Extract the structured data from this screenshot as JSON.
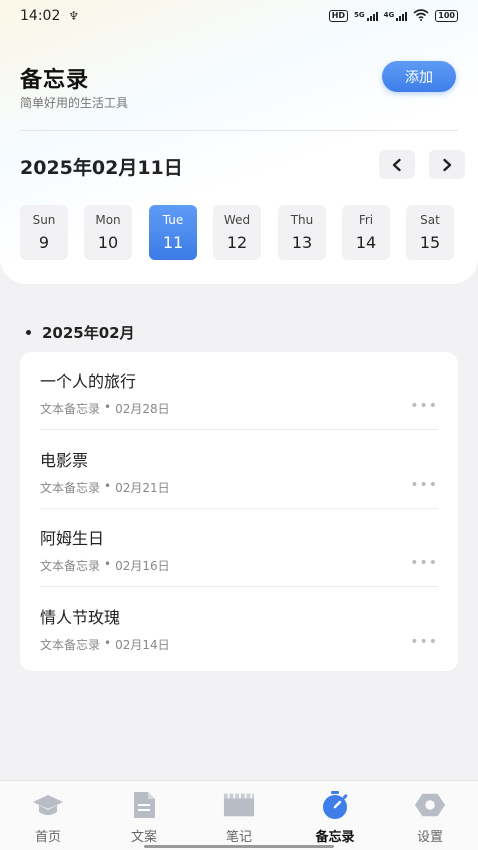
{
  "status_bar": {
    "time": "14:02",
    "hd_label": "HD",
    "net1": "5G",
    "net2": "4G",
    "battery": "100"
  },
  "header": {
    "title": "备忘录",
    "subtitle": "简单好用的生活工具",
    "add_label": "添加",
    "accent_color": "#4a88ee"
  },
  "calendar": {
    "current_date": "2025年02月11日",
    "days": [
      {
        "name": "Sun",
        "num": "9",
        "active": false
      },
      {
        "name": "Mon",
        "num": "10",
        "active": false
      },
      {
        "name": "Tue",
        "num": "11",
        "active": true
      },
      {
        "name": "Wed",
        "num": "12",
        "active": false
      },
      {
        "name": "Thu",
        "num": "13",
        "active": false
      },
      {
        "name": "Fri",
        "num": "14",
        "active": false
      },
      {
        "name": "Sat",
        "num": "15",
        "active": false
      }
    ]
  },
  "month_section": {
    "label": "2025年02月",
    "memos": [
      {
        "title": "一个人的旅行",
        "type": "文本备忘录",
        "sep": "•",
        "date": "02月28日",
        "more": "•••"
      },
      {
        "title": "电影票",
        "type": "文本备忘录",
        "sep": "•",
        "date": "02月21日",
        "more": "•••"
      },
      {
        "title": "阿姆生日",
        "type": "文本备忘录",
        "sep": "•",
        "date": "02月16日",
        "more": "•••"
      },
      {
        "title": "情人节玫瑰",
        "type": "文本备忘录",
        "sep": "•",
        "date": "02月14日",
        "more": "•••"
      }
    ]
  },
  "bottom_nav": {
    "tabs": [
      {
        "label": "首页",
        "icon": "graduation-cap-icon",
        "active": false
      },
      {
        "label": "文案",
        "icon": "document-icon",
        "active": false
      },
      {
        "label": "笔记",
        "icon": "clapperboard-icon",
        "active": false
      },
      {
        "label": "备忘录",
        "icon": "stopwatch-icon",
        "active": true
      },
      {
        "label": "设置",
        "icon": "settings-hexagon-icon",
        "active": false
      }
    ]
  }
}
